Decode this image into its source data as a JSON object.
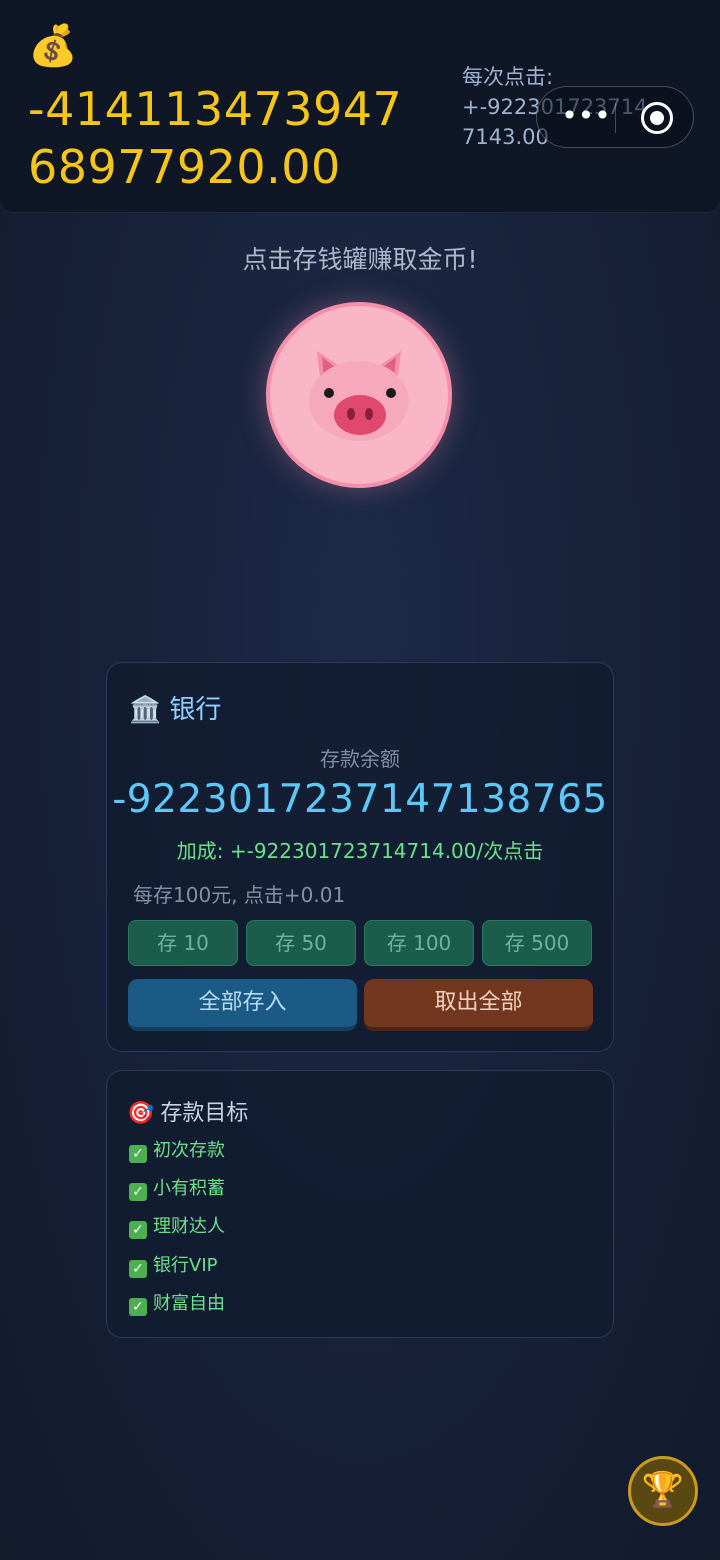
{
  "header": {
    "money_icon": "money-bag-icon",
    "balance": "-41411347394768977920.00",
    "per_click_label": "每次点击:",
    "per_click_value": "+-9223017237147143.00"
  },
  "hint": "点击存钱罐赚取金币!",
  "piggy": {
    "icon": "pig-face-icon",
    "color": "#f9b6c6"
  },
  "bank": {
    "title": "银行",
    "icon": "bank-icon",
    "deposit_label": "存款余额",
    "deposit_value": "-9223017237147138765",
    "bonus": "加成: +-922301723714714.00/次点击",
    "rate": "每存100元, 点击+0.01",
    "deposit_buttons": [
      "存 10",
      "存 50",
      "存 100",
      "存 500"
    ],
    "deposit_all": "全部存入",
    "withdraw_all": "取出全部"
  },
  "goals": {
    "title": "存款目标",
    "icon": "target-icon",
    "items": [
      "初次存款",
      "小有积蓄",
      "理财达人",
      "银行VIP",
      "财富自由"
    ]
  },
  "trophy": {
    "icon": "trophy-icon"
  },
  "colors": {
    "gold": "#f5c518",
    "blue": "#5dc7f5",
    "green": "#6ee08a",
    "pink": "#f9b6c6"
  }
}
